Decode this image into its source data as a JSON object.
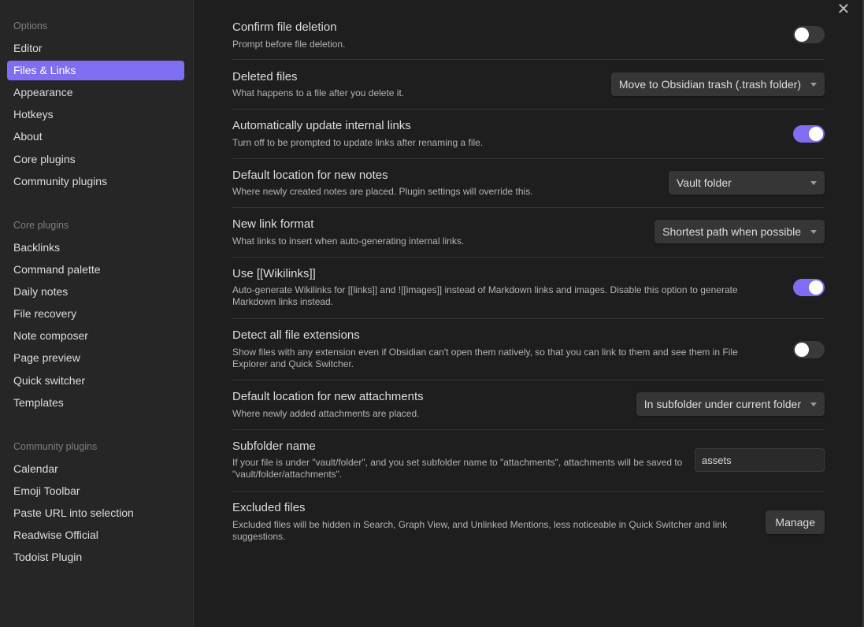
{
  "sidebar": {
    "options_title": "Options",
    "options_items": [
      {
        "label": "Editor"
      },
      {
        "label": "Files & Links"
      },
      {
        "label": "Appearance"
      },
      {
        "label": "Hotkeys"
      },
      {
        "label": "About"
      },
      {
        "label": "Core plugins"
      },
      {
        "label": "Community plugins"
      }
    ],
    "core_title": "Core plugins",
    "core_items": [
      {
        "label": "Backlinks"
      },
      {
        "label": "Command palette"
      },
      {
        "label": "Daily notes"
      },
      {
        "label": "File recovery"
      },
      {
        "label": "Note composer"
      },
      {
        "label": "Page preview"
      },
      {
        "label": "Quick switcher"
      },
      {
        "label": "Templates"
      }
    ],
    "community_title": "Community plugins",
    "community_items": [
      {
        "label": "Calendar"
      },
      {
        "label": "Emoji Toolbar"
      },
      {
        "label": "Paste URL into selection"
      },
      {
        "label": "Readwise Official"
      },
      {
        "label": "Todoist Plugin"
      }
    ],
    "active_item": "Files & Links"
  },
  "close_label": "✕",
  "settings": [
    {
      "name": "Confirm file deletion",
      "desc": "Prompt before file deletion.",
      "control": "toggle",
      "on": false
    },
    {
      "name": "Deleted files",
      "desc": "What happens to a file after you delete it.",
      "control": "dropdown",
      "value": "Move to Obsidian trash (.trash folder)"
    },
    {
      "name": "Automatically update internal links",
      "desc": "Turn off to be prompted to update links after renaming a file.",
      "control": "toggle",
      "on": true
    },
    {
      "name": "Default location for new notes",
      "desc": "Where newly created notes are placed. Plugin settings will override this.",
      "control": "dropdown",
      "value": "Vault folder"
    },
    {
      "name": "New link format",
      "desc": "What links to insert when auto-generating internal links.",
      "control": "dropdown",
      "value": "Shortest path when possible"
    },
    {
      "name": "Use [[Wikilinks]]",
      "desc": "Auto-generate Wikilinks for [[links]] and ![[images]] instead of Markdown links and images. Disable this option to generate Markdown links instead.",
      "control": "toggle",
      "on": true
    },
    {
      "name": "Detect all file extensions",
      "desc": "Show files with any extension even if Obsidian can't open them natively, so that you can link to them and see them in File Explorer and Quick Switcher.",
      "control": "toggle",
      "on": false
    },
    {
      "name": "Default location for new attachments",
      "desc": "Where newly added attachments are placed.",
      "control": "dropdown",
      "value": "In subfolder under current folder"
    },
    {
      "name": "Subfolder name",
      "desc": "If your file is under \"vault/folder\", and you set subfolder name to \"attachments\", attachments will be saved to \"vault/folder/attachments\".",
      "control": "text",
      "value": "assets"
    },
    {
      "name": "Excluded files",
      "desc": "Excluded files will be hidden in Search, Graph View, and Unlinked Mentions, less noticeable in Quick Switcher and link suggestions.",
      "control": "button",
      "value": "Manage"
    }
  ],
  "colors": {
    "accent": "#7f6df2",
    "background": "#1e1e1e",
    "sidebar": "#262626"
  }
}
